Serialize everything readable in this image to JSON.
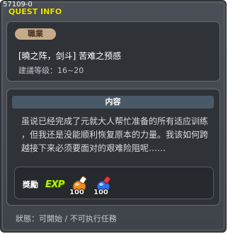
{
  "window": {
    "quest_id": "57109-0",
    "title": "QUEST INFO"
  },
  "job": {
    "tag_label": "職業",
    "quest_name": "[曉之阵，剑斗] 苦难之预感",
    "level_req": "建議等级：16~20"
  },
  "content": {
    "header": "内容",
    "lines": [
      "虽说已经完成了元就大人帮忙准备的所有适应训练",
      "，但我还是没能顺利恢复原本的力量。我该如何跨",
      "越接下来必须要面对的艰难险阻呢……"
    ]
  },
  "reward": {
    "label": "獎勵",
    "exp_label": "EXP",
    "items": [
      {
        "icon": "orange-potion-icon",
        "count": "100",
        "color": "#f08a24"
      },
      {
        "icon": "blue-potion-icon",
        "count": "100",
        "color": "#2f6fe0"
      }
    ]
  },
  "status": {
    "text": "狀態：可開始 / 不可执行任務"
  }
}
